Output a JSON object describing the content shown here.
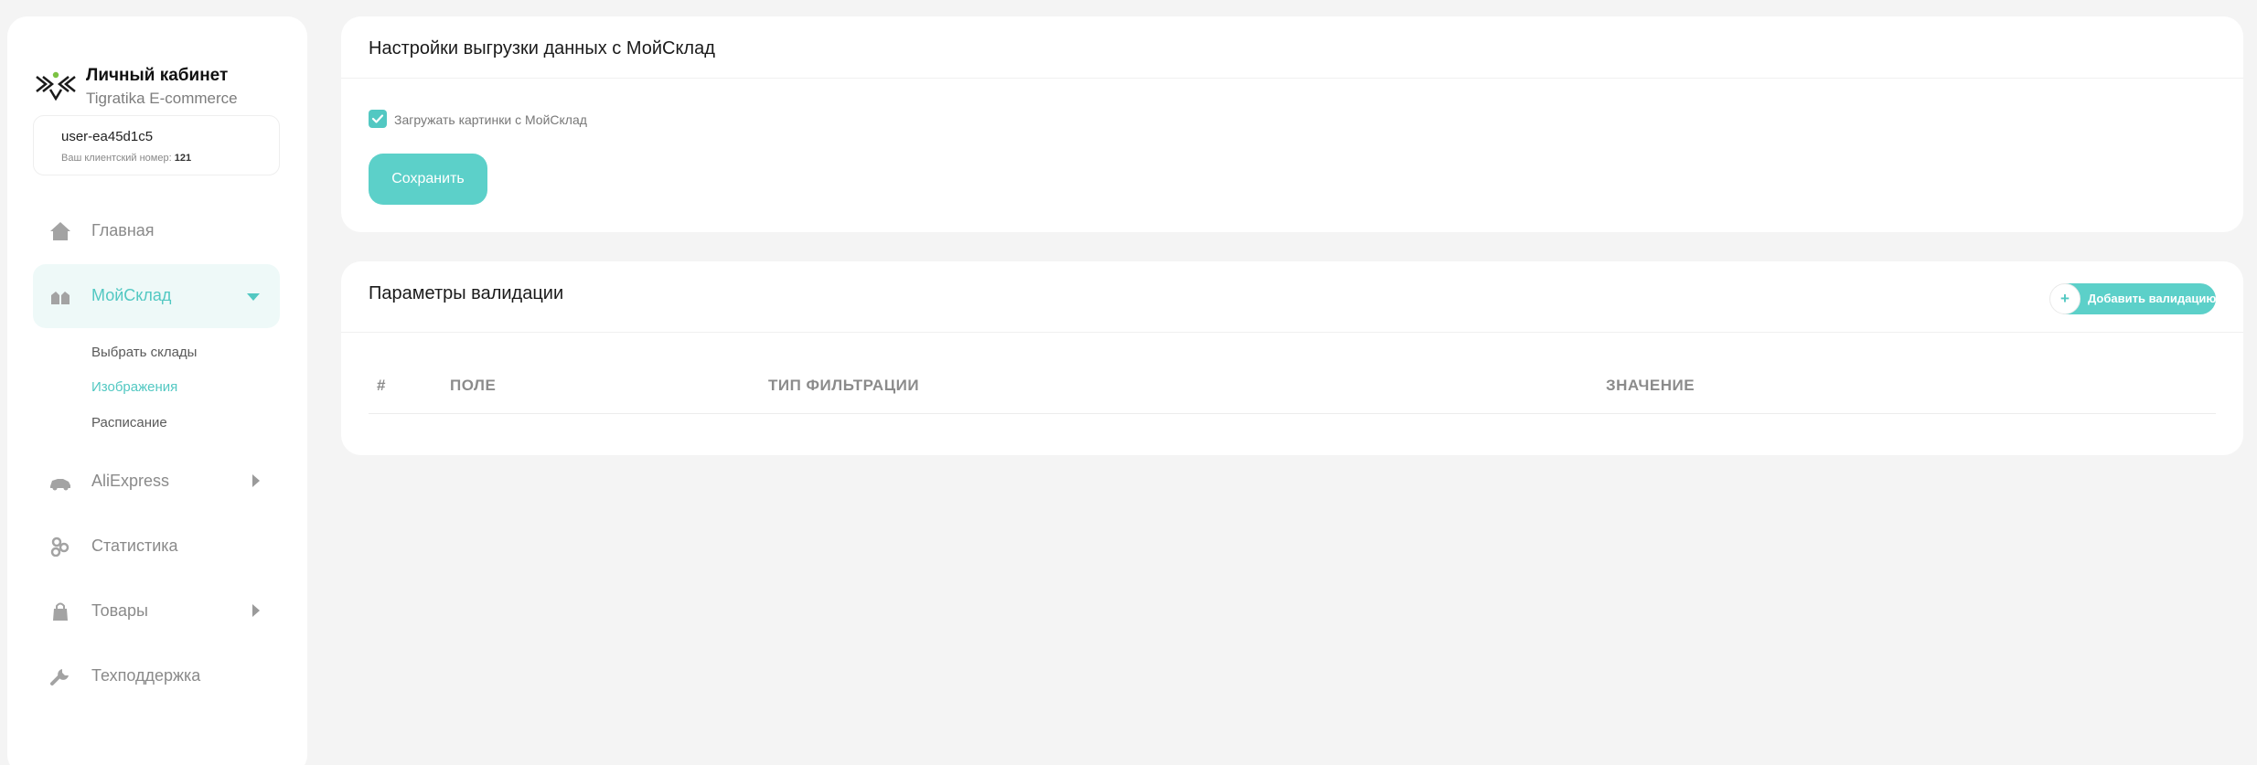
{
  "brand": {
    "title": "Личный кабинет",
    "subtitle": "Tigratika E-commerce"
  },
  "user": {
    "name": "user-ea45d1c5",
    "client_number_label": "Ваш клиентский номер:",
    "client_number": "121"
  },
  "sidebar": {
    "items": [
      {
        "label": "Главная",
        "icon": "home-icon"
      },
      {
        "label": "МойСклад",
        "icon": "warehouse-icon",
        "expanded": true
      },
      {
        "label": "AliExpress",
        "icon": "car-icon"
      },
      {
        "label": "Статистика",
        "icon": "stats-icon"
      },
      {
        "label": "Товары",
        "icon": "bag-icon"
      },
      {
        "label": "Техподдержка",
        "icon": "wrench-icon"
      }
    ],
    "subitems": [
      {
        "label": "Выбрать склады"
      },
      {
        "label": "Изображения",
        "active": true
      },
      {
        "label": "Расписание"
      }
    ]
  },
  "export_settings": {
    "title": "Настройки выгрузки данных с МойСклад",
    "checkbox_label": "Загружать картинки с МойСклад",
    "checkbox_checked": true,
    "save_label": "Сохранить"
  },
  "validation": {
    "title": "Параметры валидации",
    "add_label": "Добавить валидацию",
    "add_icon": "+",
    "columns": [
      "#",
      "ПОЛЕ",
      "ТИП ФИЛЬТРАЦИИ",
      "ЗНАЧЕНИЕ"
    ]
  },
  "colors": {
    "accent": "#52c8c2",
    "button": "#5cd0c9",
    "background": "#f4f4f4"
  }
}
